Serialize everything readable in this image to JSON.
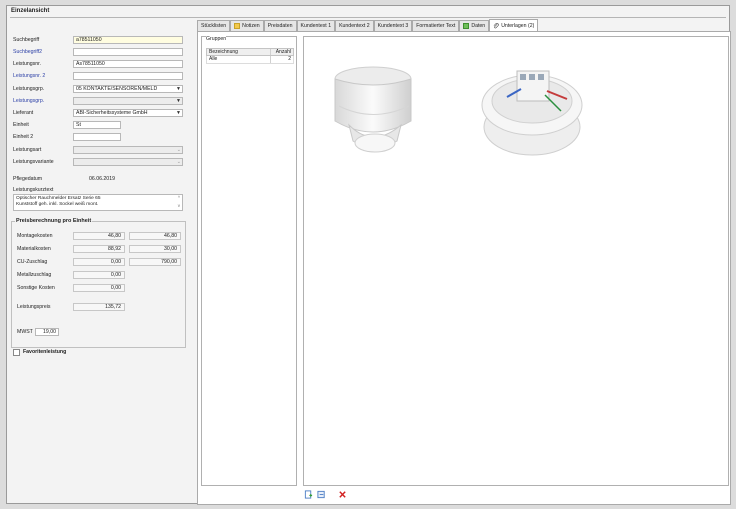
{
  "window": {
    "title": "Einzelansicht"
  },
  "form": {
    "suchbegriff": {
      "label": "Suchbegriff",
      "value": "a78511050"
    },
    "suchbegriff2": {
      "label": "Suchbegriff2",
      "value": ""
    },
    "leistungsnr": {
      "label": "Leistungsnr.",
      "value": "As78511050"
    },
    "leistungsnr2": {
      "label": "Leistungsnr. 2",
      "value": ""
    },
    "leistungsgrp": {
      "label": "Leistungsgrp.",
      "value": "05 KONTAKTE/SENSOREN/MELD"
    },
    "leistungsgrp2": {
      "label": "Leistungsgrp.",
      "value": ""
    },
    "lieferant": {
      "label": "Lieferant",
      "value": "ABI-Sicherheitssysteme GmbH"
    },
    "einheit": {
      "label": "Einheit",
      "value": "St"
    },
    "einheit2": {
      "label": "Einheit 2",
      "value": ""
    },
    "leistungsart": {
      "label": "Leistungsart",
      "value": ""
    },
    "leistungsvariante": {
      "label": "Leistungsvariante",
      "value": ""
    },
    "pflegedatum": {
      "label": "Pflegedatum",
      "value": "06.06.2019"
    },
    "kurztext": {
      "label": "Leistungskurztext",
      "line1": "Optischer Rauchmelder Ersatz Serie 65",
      "line2": "Kunststoff geh. inkl. Sockel weiß mont."
    }
  },
  "price": {
    "title": "Preisberechnung pro Einheit",
    "rows": [
      {
        "label": "Montagekosten",
        "v1": "46,80",
        "v2": "46,80"
      },
      {
        "label": "Materialkosten",
        "v1": "88,92",
        "v2": "30,00"
      },
      {
        "label": "CU-Zuschlag",
        "v1": "0,00",
        "v2": "790,00"
      },
      {
        "label": "Metallzuschlag",
        "v1": "0,00",
        "v2": ""
      },
      {
        "label": "Sonstige Kosten",
        "v1": "0,00",
        "v2": ""
      },
      {
        "label": "Leistungspreis",
        "v1": "135,72",
        "v2": ""
      }
    ],
    "mwst_label": "MWST",
    "mwst_value": "19,00"
  },
  "favorite": {
    "label": "Favoritenleistung"
  },
  "tabs": [
    {
      "label": "Stücklisten",
      "icon": ""
    },
    {
      "label": "Notizen",
      "icon": "note-icon"
    },
    {
      "label": "Preisdaten",
      "icon": ""
    },
    {
      "label": "Kundentext 1",
      "icon": ""
    },
    {
      "label": "Kundentext 2",
      "icon": ""
    },
    {
      "label": "Kundentext 3",
      "icon": ""
    },
    {
      "label": "Formatierter Text",
      "icon": ""
    },
    {
      "label": "Daten",
      "icon": "data-icon"
    },
    {
      "label": "Unterlagen (2)",
      "icon": "paperclip-icon"
    }
  ],
  "groups": {
    "title": "Gruppen",
    "headers": {
      "name": "Bezeichnung",
      "count": "Anzahl"
    },
    "rows": [
      {
        "name": "Alle",
        "count": "2"
      }
    ]
  },
  "colors": {
    "accent_blue": "#2b3fa6",
    "delete_red": "#d22020",
    "yellow_field": "#fffde0"
  }
}
